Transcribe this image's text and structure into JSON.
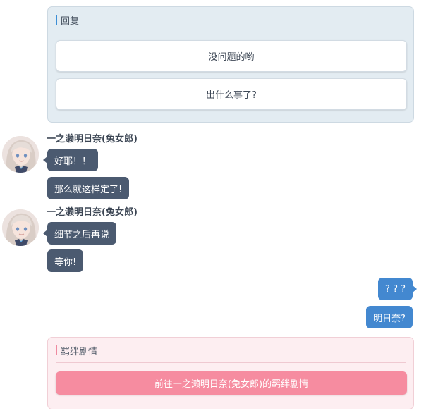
{
  "reply": {
    "title": "回复",
    "options": [
      "没问题的哟",
      "出什么事了?"
    ]
  },
  "chat": {
    "groups": [
      {
        "sender": "一之濑明日奈(兔女郎)",
        "messages": [
          "好耶！！",
          "那么就这样定了!"
        ]
      },
      {
        "sender": "一之濑明日奈(兔女郎)",
        "messages": [
          "细节之后再说",
          "等你!"
        ]
      }
    ],
    "player_messages": [
      "? ? ?",
      "明日奈?"
    ]
  },
  "bond": {
    "title": "羁绊剧情",
    "button_label": "前往一之濑明日奈(兔女郎)的羁绊剧情"
  },
  "colors": {
    "reply_panel_bg": "#e3ecf2",
    "npc_bubble": "#4b5a70",
    "player_bubble": "#4388d0",
    "bond_panel_bg": "#fdeef1",
    "bond_button": "#f68ca0",
    "accent_blue": "#3c8ed6",
    "accent_pink": "#ef8aa0"
  },
  "icons": {
    "avatar": "character-avatar-icon"
  }
}
